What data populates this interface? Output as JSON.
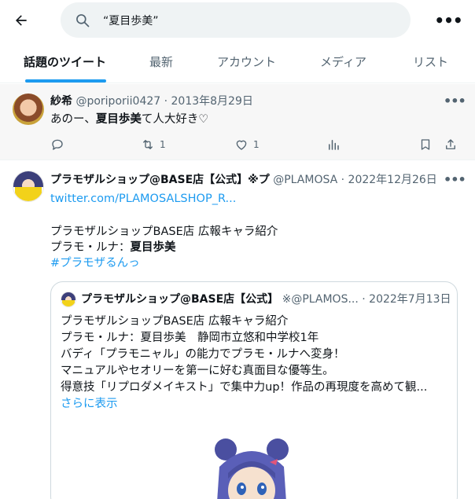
{
  "search": {
    "query": "“夏目歩美”"
  },
  "tabs": [
    {
      "label": "話題のツイート",
      "active": true
    },
    {
      "label": "最新",
      "active": false
    },
    {
      "label": "アカウント",
      "active": false
    },
    {
      "label": "メディア",
      "active": false
    },
    {
      "label": "リスト",
      "active": false
    }
  ],
  "tweets": [
    {
      "name": "紗希",
      "handle": "@poriporii0427",
      "date": "· 2013年8月29日",
      "text_before": "あのー、",
      "text_bold": "夏目歩美",
      "text_after": "て人大好き♡",
      "replies": "",
      "retweets": "1",
      "likes": "1"
    },
    {
      "name": "プラモザルショップ@BASE店【公式】※プ",
      "handle": "@PLAMOSA",
      "date": "· 2022年12月26日",
      "link": "twitter.com/PLAMOSALSHOP_R...",
      "line1": "プラモザルショップBASE店 広報キャラ紹介",
      "line2_before": "プラモ・ルナ：",
      "line2_bold": "夏目歩美",
      "hashtag": "#プラモザるんっ",
      "quote": {
        "name": "プラモザルショップ@BASE店【公式】",
        "handle": "※@PLAMOS...",
        "date": "· 2022年7月13日",
        "lines": [
          "プラモザルショップBASE店 広報キャラ紹介",
          "プラモ・ルナ：夏目歩美　静岡市立悠和中学校1年",
          "バディ「プラモニャル」の能力でプラモ・ルナへ変身！",
          "マニュアルやセオリーを第一に好む真面目な優等生。",
          "得意技「リプロダメイキスト」で集中力up！作品の再現度を高めて観..."
        ],
        "show_more": "さらに表示"
      }
    }
  ],
  "icons": {
    "back": "arrow-left-icon",
    "search": "search-icon",
    "more": "more-icon",
    "reply": "reply-icon",
    "retweet": "retweet-icon",
    "like": "heart-icon",
    "views": "analytics-icon",
    "bookmark": "bookmark-icon",
    "share": "share-icon"
  },
  "colors": {
    "accent": "#1d9bf0",
    "text": "#0f1419",
    "muted": "#536471",
    "search_bg": "#eff3f4"
  }
}
